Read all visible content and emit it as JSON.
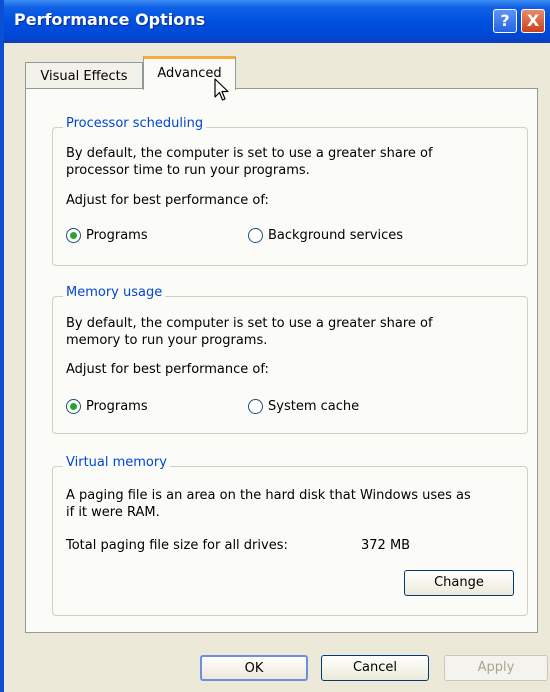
{
  "window": {
    "title": "Performance Options"
  },
  "titlebar": {
    "help_glyph": "?",
    "close_glyph": "X"
  },
  "tabs": [
    {
      "label": "Visual Effects",
      "selected": false
    },
    {
      "label": "Advanced",
      "selected": true
    }
  ],
  "processor": {
    "title": "Processor scheduling",
    "desc_line1": "By default, the computer is set to use a greater share of",
    "desc_line2": "processor time to run your programs.",
    "adjust": "Adjust for best performance of:",
    "options": [
      {
        "label": "Programs",
        "checked": true
      },
      {
        "label": "Background services",
        "checked": false
      }
    ]
  },
  "memory": {
    "title": "Memory usage",
    "desc_line1": "By default, the computer is set to use a greater share of",
    "desc_line2": "memory to run your programs.",
    "adjust": "Adjust for best performance of:",
    "options": [
      {
        "label": "Programs",
        "checked": true
      },
      {
        "label": "System cache",
        "checked": false
      }
    ]
  },
  "virtual": {
    "title": "Virtual memory",
    "desc_line1": "A paging file is an area on the hard disk that Windows uses as",
    "desc_line2": "if it were RAM.",
    "total_label": "Total paging file size for all drives:",
    "total_value": "372 MB",
    "change_label": "Change"
  },
  "footer": {
    "ok": "OK",
    "cancel": "Cancel",
    "apply": "Apply"
  },
  "colors": {
    "accent": "#0046d5",
    "titlebar": "#0050e0",
    "selected_tab": "#f7a93b"
  }
}
